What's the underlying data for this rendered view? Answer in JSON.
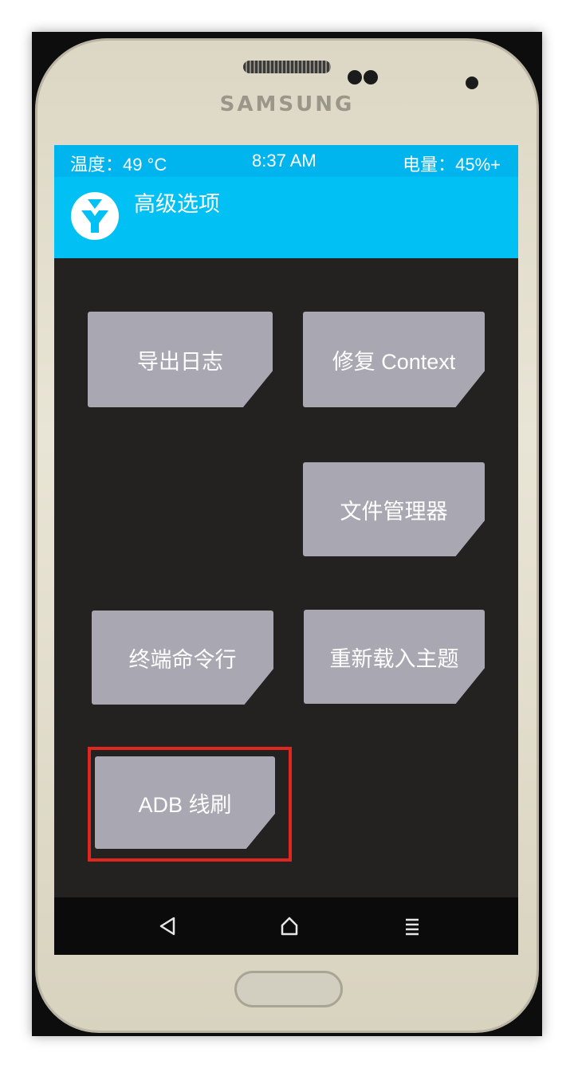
{
  "device": {
    "brand": "SAMSUNG"
  },
  "status_bar": {
    "temperature": "温度：49 °C",
    "time": "8:37 AM",
    "battery": "电量：45%+"
  },
  "header": {
    "title": "高级选项",
    "logo_icon": "twrp-logo-icon"
  },
  "menu": {
    "export_log": "导出日志",
    "fix_context": "修复 Context",
    "file_manager": "文件管理器",
    "terminal": "终端命令行",
    "reload_theme": "重新载入主题",
    "adb_sideload": "ADB 线刷"
  },
  "navigation": {
    "back_icon": "back-triangle-icon",
    "home_icon": "home-icon",
    "menu_icon": "menu-lines-icon"
  },
  "annotation": {
    "highlight_color": "#e0261f"
  },
  "colors": {
    "accent": "#00c0f4",
    "tile": "#a9a7b1",
    "screen_bg": "#232220"
  }
}
